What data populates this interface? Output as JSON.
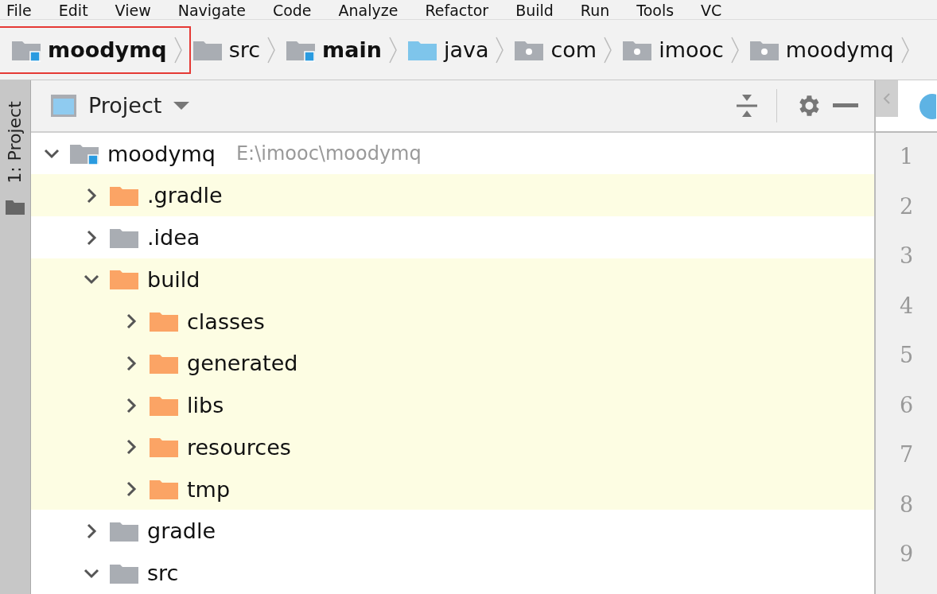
{
  "menu": [
    "File",
    "Edit",
    "View",
    "Navigate",
    "Code",
    "Analyze",
    "Refactor",
    "Build",
    "Run",
    "Tools",
    "VC"
  ],
  "breadcrumbs": [
    {
      "label": "moodymq",
      "kind": "module",
      "bold": true,
      "highlighted": true
    },
    {
      "label": "src",
      "kind": "folder",
      "bold": false,
      "highlighted": false
    },
    {
      "label": "main",
      "kind": "module",
      "bold": true,
      "highlighted": false
    },
    {
      "label": "java",
      "kind": "source",
      "bold": false,
      "highlighted": false
    },
    {
      "label": "com",
      "kind": "package",
      "bold": false,
      "highlighted": false
    },
    {
      "label": "imooc",
      "kind": "package",
      "bold": false,
      "highlighted": false
    },
    {
      "label": "moodymq",
      "kind": "package",
      "bold": false,
      "highlighted": false
    }
  ],
  "tool_stripe": {
    "label": "1: Project"
  },
  "panel": {
    "title": "Project"
  },
  "tree": [
    {
      "label": "moodymq",
      "path": "E:\\imooc\\moodymq",
      "kind": "module",
      "expanded": true,
      "highlighted": false,
      "children": [
        {
          "label": ".gradle",
          "kind": "excluded",
          "expanded": false,
          "highlighted": true
        },
        {
          "label": ".idea",
          "kind": "folder",
          "expanded": false,
          "highlighted": false
        },
        {
          "label": "build",
          "kind": "excluded",
          "expanded": true,
          "highlighted": true,
          "children": [
            {
              "label": "classes",
              "kind": "excluded",
              "expanded": false,
              "highlighted": true
            },
            {
              "label": "generated",
              "kind": "excluded",
              "expanded": false,
              "highlighted": true
            },
            {
              "label": "libs",
              "kind": "excluded",
              "expanded": false,
              "highlighted": true
            },
            {
              "label": "resources",
              "kind": "excluded",
              "expanded": false,
              "highlighted": true
            },
            {
              "label": "tmp",
              "kind": "excluded",
              "expanded": false,
              "highlighted": true
            }
          ]
        },
        {
          "label": "gradle",
          "kind": "folder",
          "expanded": false,
          "highlighted": false
        },
        {
          "label": "src",
          "kind": "folder",
          "expanded": true,
          "highlighted": false
        }
      ]
    }
  ],
  "editor": {
    "line_numbers": [
      "1",
      "2",
      "3",
      "4",
      "5",
      "6",
      "7",
      "8",
      "9"
    ]
  }
}
